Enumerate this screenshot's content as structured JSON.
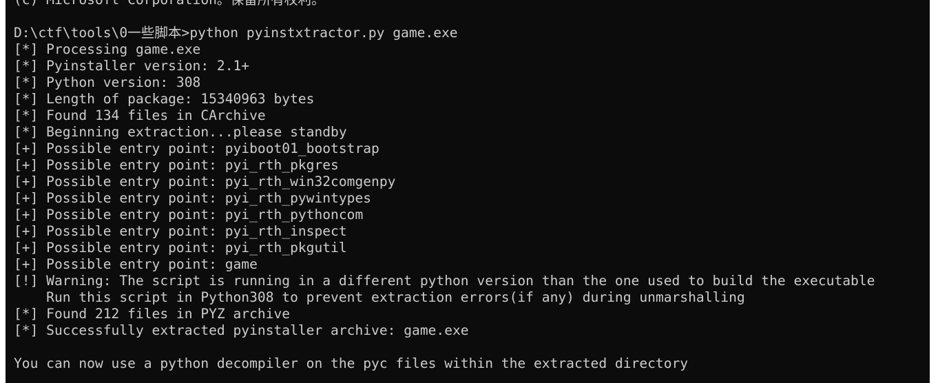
{
  "terminal": {
    "lines": [
      "(c) Microsoft Corporation。保留所有权利。",
      "",
      "D:\\ctf\\tools\\0一些脚本>python pyinstxtractor.py game.exe",
      "[*] Processing game.exe",
      "[*] Pyinstaller version: 2.1+",
      "[*] Python version: 308",
      "[*] Length of package: 15340963 bytes",
      "[*] Found 134 files in CArchive",
      "[*] Beginning extraction...please standby",
      "[+] Possible entry point: pyiboot01_bootstrap",
      "[+] Possible entry point: pyi_rth_pkgres",
      "[+] Possible entry point: pyi_rth_win32comgenpy",
      "[+] Possible entry point: pyi_rth_pywintypes",
      "[+] Possible entry point: pyi_rth_pythoncom",
      "[+] Possible entry point: pyi_rth_inspect",
      "[+] Possible entry point: pyi_rth_pkgutil",
      "[+] Possible entry point: game",
      "[!] Warning: The script is running in a different python version than the one used to build the executable",
      "    Run this script in Python308 to prevent extraction errors(if any) during unmarshalling",
      "[*] Found 212 files in PYZ archive",
      "[*] Successfully extracted pyinstaller archive: game.exe",
      "",
      "You can now use a python decompiler on the pyc files within the extracted directory"
    ],
    "colors": {
      "background": "#0c0c0c",
      "text": "#cccccc"
    }
  }
}
